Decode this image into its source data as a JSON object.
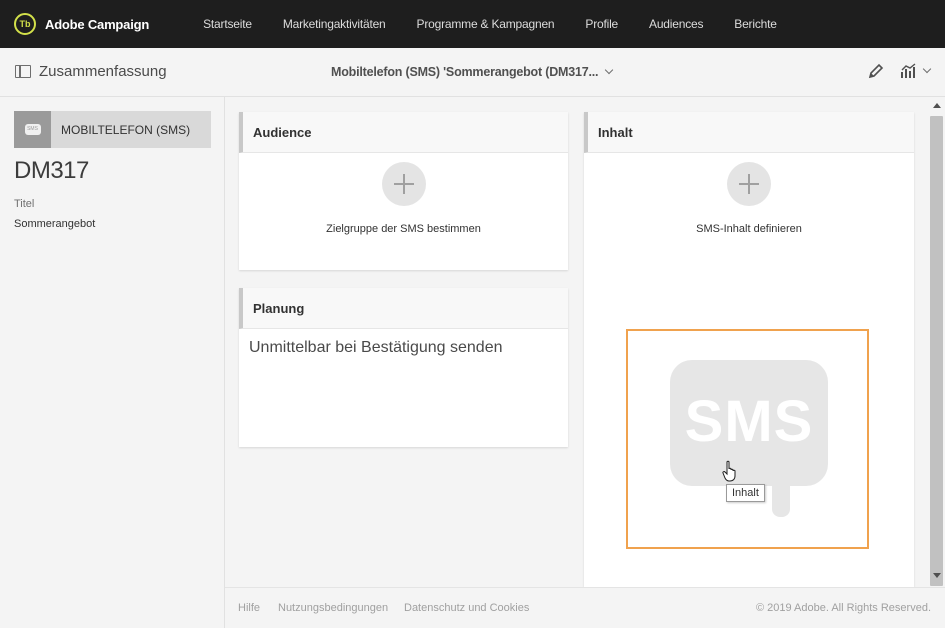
{
  "app": {
    "logo_text": "Tb",
    "name": "Adobe Campaign"
  },
  "nav": {
    "items": [
      {
        "label": "Startseite"
      },
      {
        "label": "Marketingaktivitäten"
      },
      {
        "label": "Programme & Kampagnen"
      },
      {
        "label": "Profile"
      },
      {
        "label": "Audiences"
      },
      {
        "label": "Berichte"
      }
    ]
  },
  "subheader": {
    "summary_label": "Zusammenfassung",
    "document_title": "Mobiltelefon (SMS) 'Sommerangebot (DM317..."
  },
  "sidebar": {
    "channel_label": "MOBILTELEFON (SMS)",
    "channel_icon_text": "SMS",
    "code": "DM317",
    "title_key": "Titel",
    "title_value": "Sommerangebot"
  },
  "cards": {
    "audience": {
      "title": "Audience",
      "hint": "Zielgruppe der SMS bestimmen"
    },
    "planung": {
      "title": "Planung",
      "text": "Unmittelbar bei Bestätigung senden"
    },
    "inhalt": {
      "title": "Inhalt",
      "hint": "SMS-Inhalt definieren",
      "preview_text": "SMS",
      "tooltip": "Inhalt"
    }
  },
  "footer": {
    "links": [
      "Hilfe",
      "Nutzungsbedingungen",
      "Datenschutz und Cookies"
    ],
    "copyright": "© 2019 Adobe. All Rights Reserved."
  },
  "colors": {
    "topbar": "#1e1e1e",
    "highlight": "#f0a24e",
    "logo_accent": "#d2e04a"
  }
}
